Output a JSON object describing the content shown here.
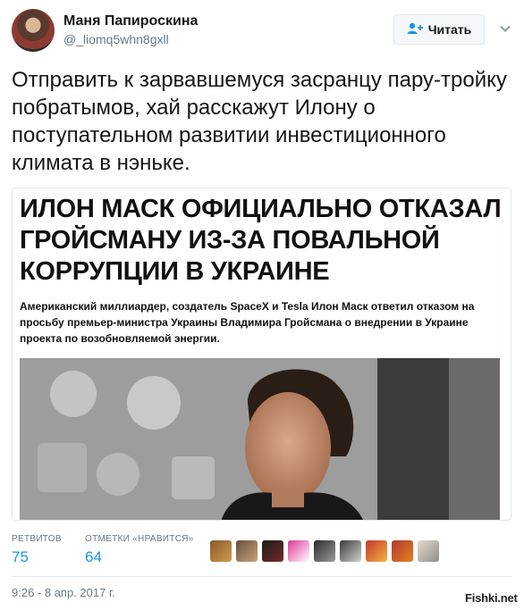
{
  "author": {
    "name": "Маня Папироскина",
    "handle": "@_liomq5whn8gxll"
  },
  "follow_button": {
    "label": "Читать",
    "icon": "add-user-icon"
  },
  "menu_icon": "chevron-down-icon",
  "tweet": {
    "text": "Отправить к зарвавшемуся засранцу пару-тройку побратымов, хай расскажут Илону о поступательном развитии инвестиционного климата в нэньке."
  },
  "card": {
    "headline": "ИЛОН МАСК ОФИЦИАЛЬНО ОТКАЗАЛ ГРОЙСМАНУ ИЗ-ЗА ПОВАЛЬНОЙ КОРРУПЦИИ В УКРАИНЕ",
    "lead": "Американский миллиардер, создатель SpaceX и Tesla Илон Маск ответил отказом на просьбу премьер-министра Украины Владимира Гройсмана о внедрении в Украине проекта по возобновляемой энергии."
  },
  "stats": {
    "retweets_label": "РЕТВИТОВ",
    "retweets_value": "75",
    "likes_label": "ОТМЕТКИ «НРАВИТСЯ»",
    "likes_value": "64"
  },
  "likers_count": 9,
  "timestamp": "9:26 - 8 апр. 2017 г.",
  "watermark": "Fishki.net",
  "colors": {
    "link_blue": "#1b95e0",
    "muted_gray": "#657786",
    "border": "#e1e8ed"
  }
}
